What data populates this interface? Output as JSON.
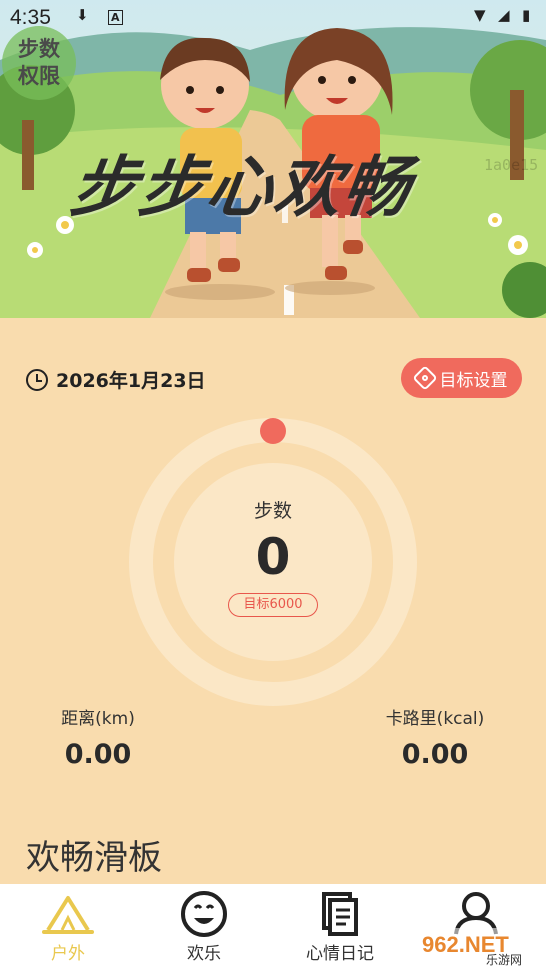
{
  "status_bar": {
    "time": "4:35"
  },
  "hero": {
    "permission_badge": "步数\n权限",
    "title": "步步心欢畅",
    "id_text": "1a0e15"
  },
  "panel": {
    "date": "2026年1月23日",
    "goal_button": "目标设置",
    "steps_label": "步数",
    "steps_value": "0",
    "steps_goal": "目标6000",
    "distance_label": "距离(km)",
    "distance_value": "0.00",
    "calories_label": "卡路里(kcal)",
    "calories_value": "0.00",
    "section_title": "欢畅滑板"
  },
  "nav": [
    {
      "label": "户外",
      "icon": "tent-icon",
      "active": true
    },
    {
      "label": "欢乐",
      "icon": "smile-icon",
      "active": false
    },
    {
      "label": "心情日记",
      "icon": "notes-icon",
      "active": false
    },
    {
      "label": "",
      "icon": "person-icon",
      "active": false
    }
  ],
  "watermark": {
    "text": "962.NET",
    "sub": "乐游网"
  },
  "colors": {
    "accent": "#f06a5d",
    "background": "#f9dcae",
    "nav_active": "#e9c84e"
  }
}
